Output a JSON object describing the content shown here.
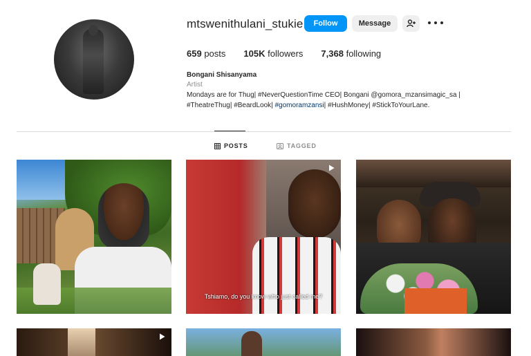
{
  "profile": {
    "username": "mtswenithulani_stukie",
    "full_name": "Bongani Shisanyama",
    "category": "Artist",
    "bio_line1_prefix": "Mondays are for Thug| #NeverQuestionTime CEO| Bongani @gomora_mzansimagic_sa |",
    "bio_line2_a": "#TheatreThug| #BeardLook| ",
    "bio_line2_link": "#gomoramzansi",
    "bio_line2_b": "| #HushMoney| #StickToYourLane."
  },
  "actions": {
    "follow_label": "Follow",
    "message_label": "Message"
  },
  "stats": {
    "posts_count": "659",
    "posts_label": "posts",
    "followers_count": "105K",
    "followers_label": "followers",
    "following_count": "7,368",
    "following_label": "following"
  },
  "tabs": {
    "posts_label": "POSTS",
    "tagged_label": "TAGGED"
  },
  "posts": [
    {
      "caption": "",
      "is_reel": false
    },
    {
      "caption": "Tshiamo, do you know who just called me?",
      "is_reel": true
    },
    {
      "caption": "",
      "is_reel": false
    },
    {
      "caption": "",
      "is_reel": true
    },
    {
      "caption": "",
      "is_reel": false
    },
    {
      "caption": "",
      "is_reel": false
    }
  ],
  "colors": {
    "follow_button": "#0095f6",
    "secondary_button": "#efefef",
    "link": "#00376b",
    "muted_text": "#8e8e8e"
  }
}
